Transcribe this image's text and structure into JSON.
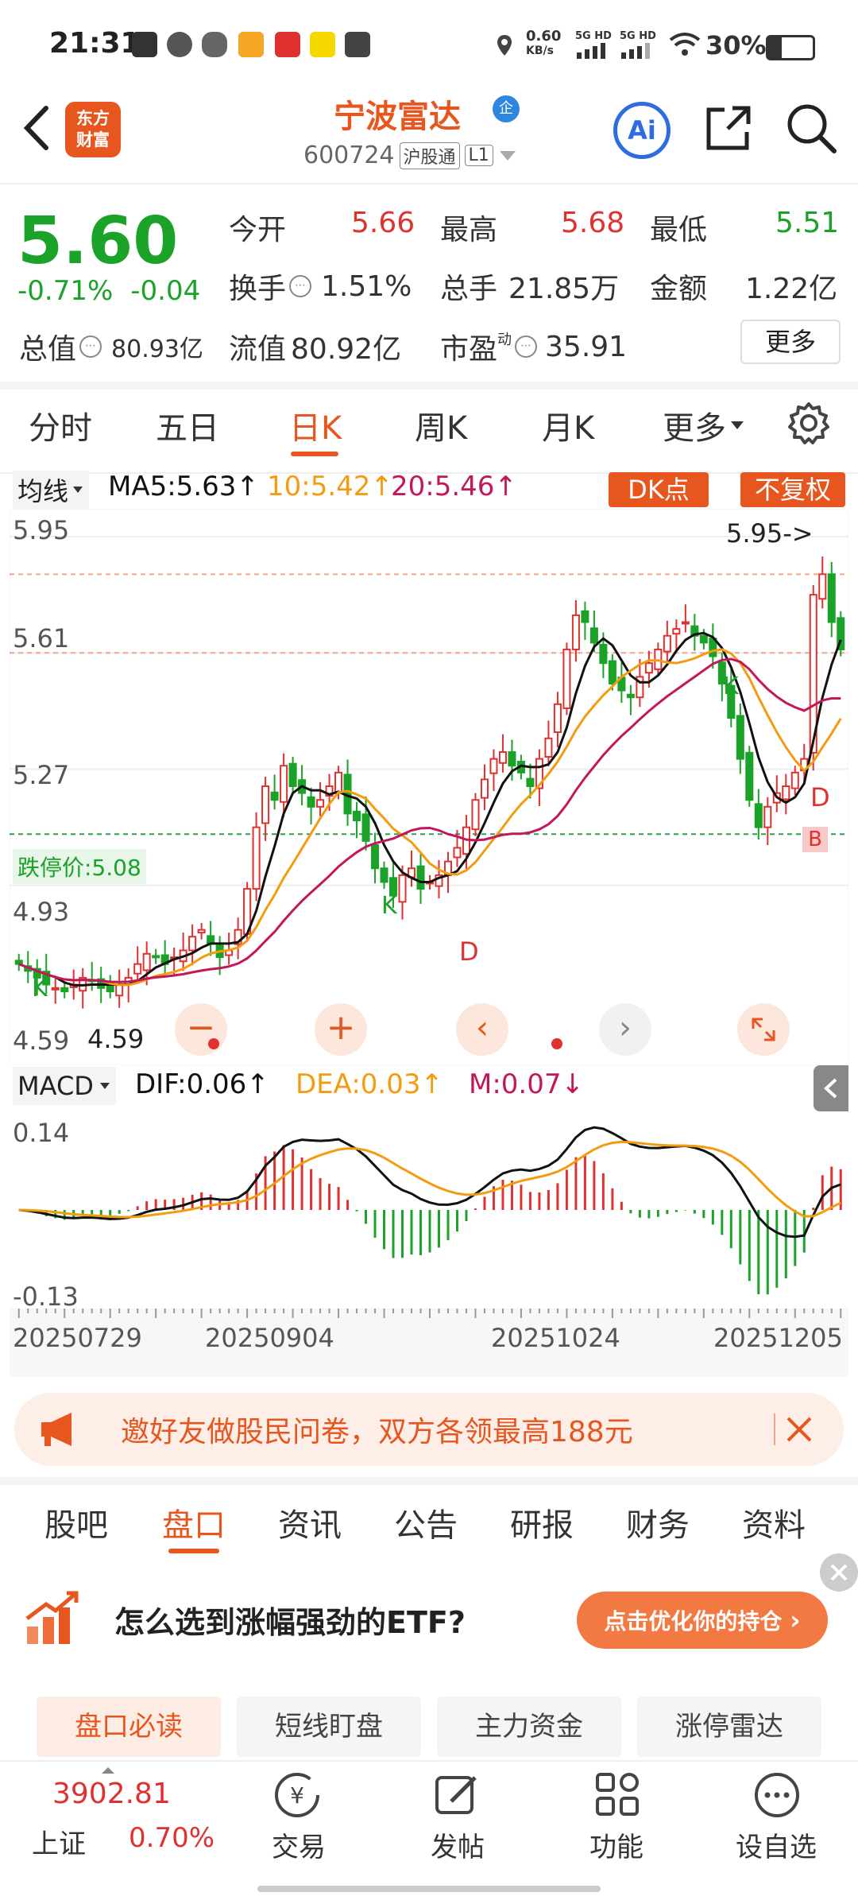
{
  "status_bar": {
    "time": "21:31",
    "speed": "0.60",
    "speed_unit": "KB/s",
    "net1": "5G HD",
    "net2": "5G HD",
    "battery": "30%"
  },
  "header": {
    "logo_text_1": "东方",
    "logo_text_2": "财富",
    "stock_name": "宁波富达",
    "badge": "企",
    "stock_code": "600724",
    "market_tag": "沪股通",
    "level_tag": "L1",
    "ai_label": "Ai"
  },
  "quote": {
    "price": "5.60",
    "change_pct": "-0.71%",
    "change": "-0.04",
    "open_label": "今开",
    "open": "5.66",
    "high_label": "最高",
    "high": "5.68",
    "low_label": "最低",
    "low": "5.51",
    "turnover_label": "换手",
    "turnover": "1.51%",
    "volume_label": "总手",
    "volume": "21.85万",
    "amount_label": "金额",
    "amount": "1.22亿",
    "mcap_label": "总值",
    "mcap": "80.93亿",
    "float_label": "流值",
    "float_val": "80.92亿",
    "pe_label": "市盈",
    "pe_sup": "动",
    "pe": "35.91",
    "more": "更多"
  },
  "kline_tabs": [
    "分时",
    "五日",
    "日K",
    "周K",
    "月K",
    "更多"
  ],
  "active_kline_tab": "日K",
  "indicators": {
    "ma_select": "均线",
    "ma5": "MA5:5.63↑",
    "ma10": "10:5.42↑",
    "ma20": "20:5.46↑",
    "dk_btn": "DK点",
    "fq_btn": "不复权",
    "limit_down": "跌停价:5.08",
    "high_note": "5.95->",
    "low_note": "4.59",
    "macd_select": "MACD",
    "dif": "DIF:0.06↑",
    "dea": "DEA:0.03↑",
    "m": "M:0.07↓"
  },
  "colors": {
    "accent": "#e8561f",
    "up": "#e03131",
    "down": "#1aa229",
    "ma5": "#111111",
    "ma10": "#f39c12",
    "ma20": "#c2185b"
  },
  "chart_data": {
    "type": "candlestick",
    "price_ticks": [
      "5.95",
      "5.61",
      "5.27",
      "4.93",
      "4.59"
    ],
    "ylim": [
      4.59,
      5.95
    ],
    "macd_ticks": [
      "0.14",
      "-0.13"
    ],
    "date_labels": [
      "20250729",
      "20250904",
      "20251024",
      "20251205"
    ],
    "markers": [
      "K",
      "K",
      "K",
      "D",
      "D",
      "B"
    ],
    "reference_lines": [
      {
        "label": "跌停价:5.08",
        "value": 5.08
      },
      {
        "value": 5.84
      },
      {
        "value": 5.61
      }
    ]
  },
  "banner": {
    "text": "邀好友做股民问卷，双方各领最高188元"
  },
  "bottom_tabs": [
    "股吧",
    "盘口",
    "资讯",
    "公告",
    "研报",
    "财务",
    "资料"
  ],
  "active_bottom_tab": "盘口",
  "ad": {
    "title": "怎么选到涨幅强劲的ETF?",
    "button": "点击优化你的持仓"
  },
  "sub_tabs": [
    "盘口必读",
    "短线盯盘",
    "主力资金",
    "涨停雷达"
  ],
  "index": {
    "value": "3902.81",
    "name": "上证",
    "change": "0.70%"
  },
  "nav": [
    "交易",
    "发帖",
    "功能",
    "设自选"
  ]
}
